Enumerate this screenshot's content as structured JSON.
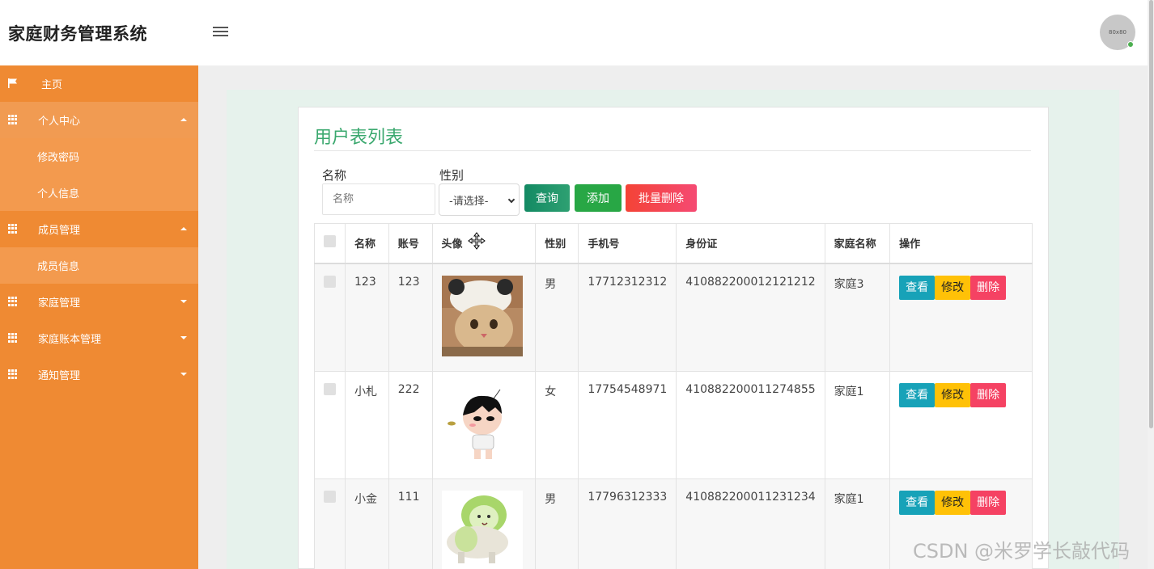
{
  "header": {
    "app_title": "家庭财务管理系统",
    "avatar_text": "80x80"
  },
  "sidebar": {
    "items": [
      {
        "label": "主页",
        "icon": "flag-icon",
        "active": false
      },
      {
        "label": "个人中心",
        "icon": "grid-icon",
        "expanded": true
      },
      {
        "label": "修改密码",
        "sub": true
      },
      {
        "label": "个人信息",
        "sub": true
      },
      {
        "label": "成员管理",
        "icon": "grid-icon",
        "expanded": true
      },
      {
        "label": "成员信息",
        "sub": true
      },
      {
        "label": "家庭管理",
        "icon": "grid-icon",
        "expanded": false
      },
      {
        "label": "家庭账本管理",
        "icon": "grid-icon",
        "expanded": false
      },
      {
        "label": "通知管理",
        "icon": "grid-icon",
        "expanded": false
      }
    ]
  },
  "page": {
    "title": "用户表列表"
  },
  "search": {
    "name_label": "名称",
    "name_placeholder": "名称",
    "gender_label": "性别",
    "gender_selected": "-请选择-",
    "query_label": "查询",
    "add_label": "添加",
    "batch_delete_label": "批量删除"
  },
  "table": {
    "headers": [
      "名称",
      "账号",
      "头像",
      "性别",
      "手机号",
      "身份证",
      "家庭名称",
      "操作"
    ],
    "rows": [
      {
        "name": "123",
        "account": "123",
        "avatar": "cat-photo",
        "gender": "男",
        "phone": "17712312312",
        "id_card": "410882200012121212",
        "family": "家庭3"
      },
      {
        "name": "小札",
        "account": "222",
        "avatar": "cartoon-boy",
        "gender": "女",
        "phone": "17754548971",
        "id_card": "410882200011274855",
        "family": "家庭1"
      },
      {
        "name": "小金",
        "account": "111",
        "avatar": "cabbage-dog",
        "gender": "男",
        "phone": "17796312333",
        "id_card": "410882200011231234",
        "family": "家庭1"
      }
    ],
    "actions": {
      "view": "查看",
      "edit": "修改",
      "delete": "删除"
    }
  },
  "watermark": "CSDN @米罗学长敲代码",
  "colors": {
    "sidebar": "#ef8a33",
    "title_green": "#3aa86e",
    "query_btn": "#1e9468",
    "add_btn": "#28a745",
    "delete_btn": "#f54263",
    "view_btn": "#17a2b8",
    "edit_btn": "#ffc107"
  }
}
